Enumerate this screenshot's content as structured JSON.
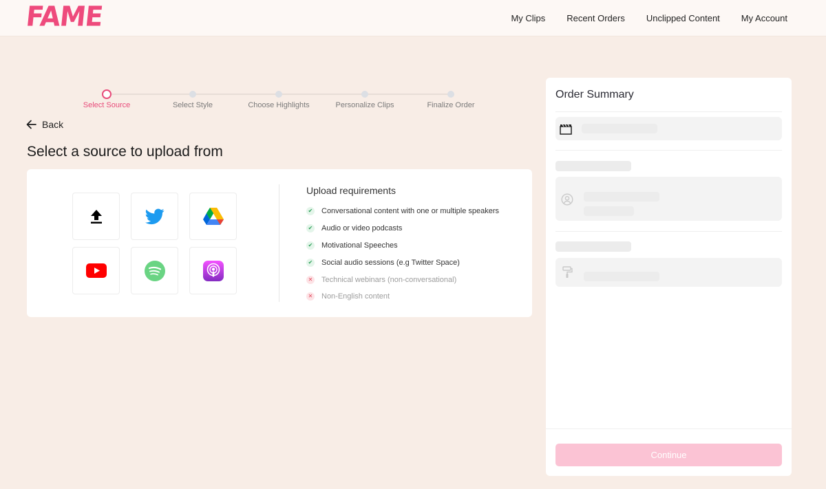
{
  "brand": {
    "logo_text": "FAME",
    "accent_color": "#ee4a7c"
  },
  "nav": {
    "items": [
      {
        "label": "My Clips"
      },
      {
        "label": "Recent Orders"
      },
      {
        "label": "Unclipped Content"
      },
      {
        "label": "My Account"
      }
    ]
  },
  "stepper": {
    "steps": [
      {
        "label": "Select Source",
        "active": true
      },
      {
        "label": "Select Style",
        "active": false
      },
      {
        "label": "Choose Highlights",
        "active": false
      },
      {
        "label": "Personalize Clips",
        "active": false
      },
      {
        "label": "Finalize Order",
        "active": false
      }
    ]
  },
  "back_label": "Back",
  "page_title": "Select a source to upload from",
  "sources": [
    {
      "name": "upload",
      "icon": "upload-icon"
    },
    {
      "name": "twitter",
      "icon": "twitter-icon"
    },
    {
      "name": "google-drive",
      "icon": "google-drive-icon"
    },
    {
      "name": "youtube",
      "icon": "youtube-icon"
    },
    {
      "name": "spotify",
      "icon": "spotify-icon"
    },
    {
      "name": "apple-podcasts",
      "icon": "apple-podcasts-icon"
    }
  ],
  "requirements": {
    "title": "Upload requirements",
    "items": [
      {
        "text": "Conversational content with one or multiple speakers",
        "allowed": true
      },
      {
        "text": "Audio or video podcasts",
        "allowed": true
      },
      {
        "text": "Motivational Speeches",
        "allowed": true
      },
      {
        "text": "Social audio sessions (e.g Twitter Space)",
        "allowed": true
      },
      {
        "text": "Technical webinars (non-conversational)",
        "allowed": false
      },
      {
        "text": "Non-English content",
        "allowed": false
      }
    ]
  },
  "summary": {
    "title": "Order Summary",
    "icons": [
      "clapperboard-icon",
      "user-circle-icon",
      "paint-roller-icon"
    ],
    "continue_label": "Continue",
    "continue_enabled": false
  }
}
